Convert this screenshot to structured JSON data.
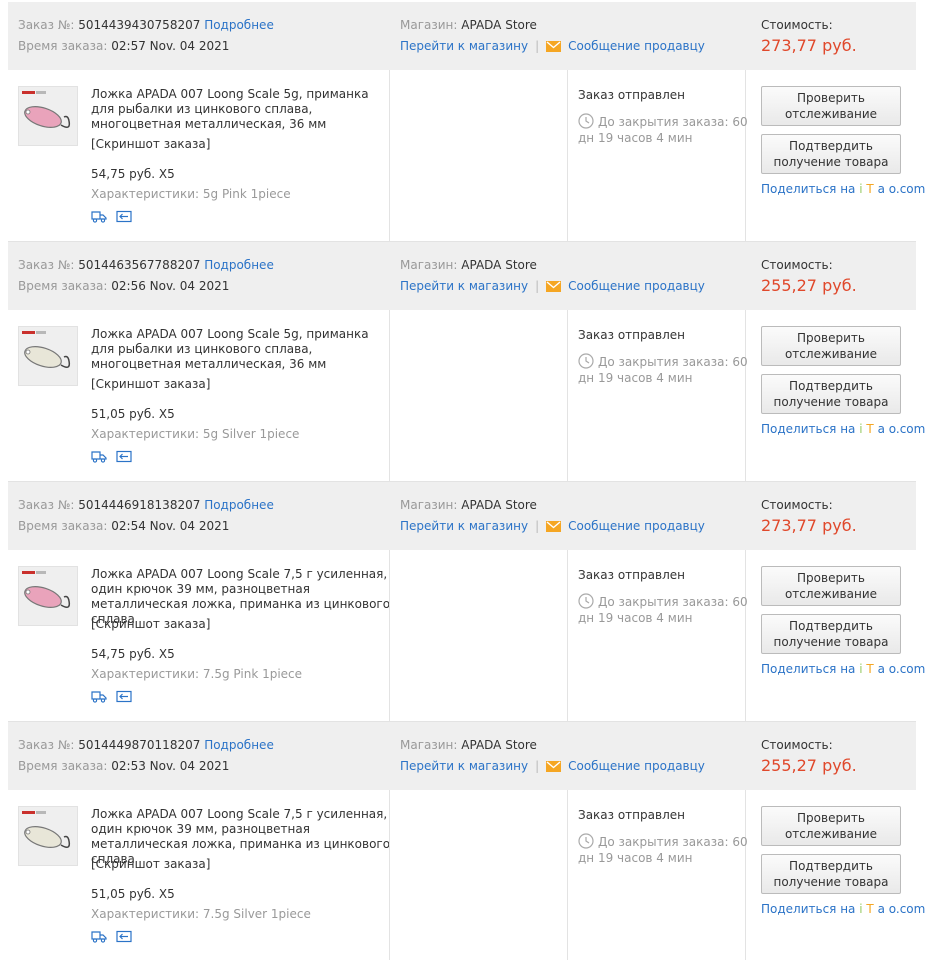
{
  "labels": {
    "order_label": "Заказ №:",
    "details_link": "Подробнее",
    "time_label": "Время заказа:",
    "store_label": "Магазин:",
    "go_store": "Перейти к магазину",
    "separator": "|",
    "message_seller": "Сообщение продавцу",
    "cost_label": "Стоимость:",
    "screenshot": "[Скриншот заказа]",
    "specs_label": "Характеристики:",
    "status": "Заказ отправлен",
    "close_label": "До закрытия заказа: 60 дн 19 часов 4 мин",
    "btn_track": "Проверить отслеживание",
    "btn_confirm": "Подтвердить получение товара",
    "share_prefix": "Поделиться на ",
    "share_i": "i",
    "share_t": "T",
    "share_a": "a",
    "share_rest": "o.com"
  },
  "colors": {
    "price": "#e0482b",
    "link": "#2b73c7",
    "header_bg": "#efefef",
    "mail_icon": "#f5a623"
  },
  "orders": [
    {
      "number": "5014439430758207",
      "time": "02:57 Nov. 04 2021",
      "store": "APADA Store",
      "cost": "273,77 руб.",
      "title": "Ложка APADA 007 Loong Scale 5g, приманка для рыбалки из цинкового сплава, многоцветная металлическая, 36 мм",
      "price": "54,75 руб. X5",
      "specs": "5g Pink 1piece",
      "lure_color": "#e9a3bb"
    },
    {
      "number": "5014463567788207",
      "time": "02:56 Nov. 04 2021",
      "store": "APADA Store",
      "cost": "255,27 руб.",
      "title": "Ложка APADA 007 Loong Scale 5g, приманка для рыбалки из цинкового сплава, многоцветная металлическая, 36 мм",
      "price": "51,05 руб. X5",
      "specs": "5g Silver 1piece",
      "lure_color": "#e8e6d8"
    },
    {
      "number": "5014446918138207",
      "time": "02:54 Nov. 04 2021",
      "store": "APADA Store",
      "cost": "273,77 руб.",
      "title": "Ложка APADA 007 Loong Scale 7,5 г усиленная, один крючок 39 мм, разноцветная металлическая ложка, приманка из цинкового сплава",
      "price": "54,75 руб. X5",
      "specs": "7.5g Pink 1piece",
      "lure_color": "#e9a3bb"
    },
    {
      "number": "5014449870118207",
      "time": "02:53 Nov. 04 2021",
      "store": "APADA Store",
      "cost": "255,27 руб.",
      "title": "Ложка APADA 007 Loong Scale 7,5 г усиленная, один крючок 39 мм, разноцветная металлическая ложка, приманка из цинкового сплава",
      "price": "51,05 руб. X5",
      "specs": "7.5g Silver 1piece",
      "lure_color": "#e8e6d8"
    }
  ]
}
